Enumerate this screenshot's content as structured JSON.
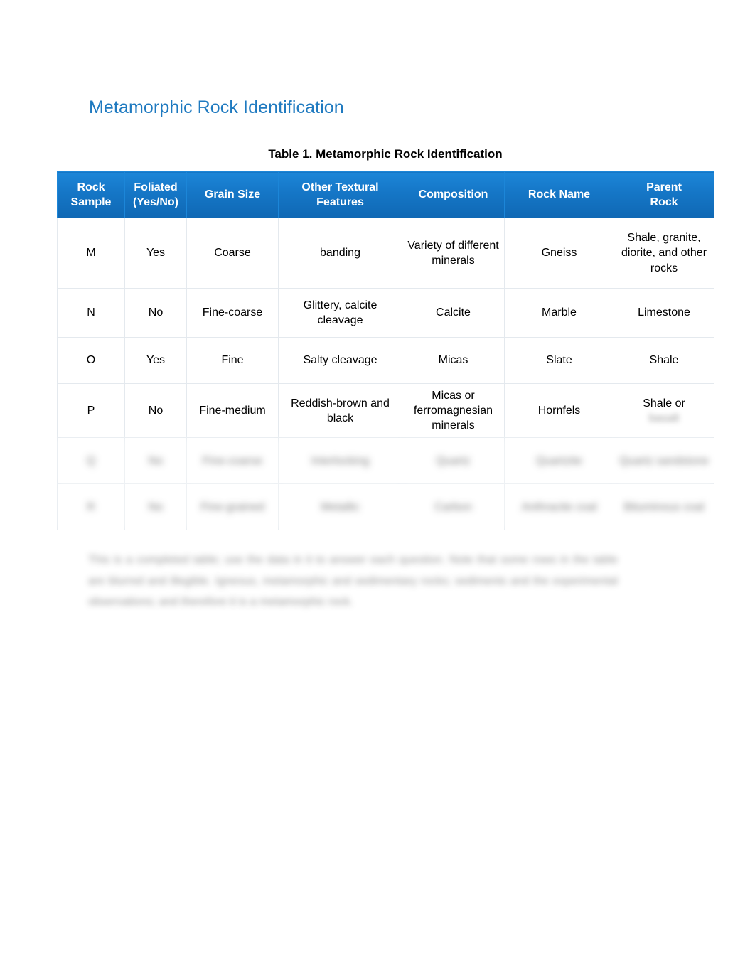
{
  "document": {
    "title": "Metamorphic Rock Identification",
    "title_color": "#1f7ac0",
    "table_caption": "Table 1. Metamorphic Rock Identification",
    "body_note": "This is a completed table; use the data in it to answer each question. Note that some rows in the table are blurred and illegible. Igneous, metamorphic and sedimentary rocks; sediments and the experimental observations; and therefore it is a metamorphic rock."
  },
  "table": {
    "header_color": "#1576c6",
    "header_text_color": "#ffffff",
    "columns": [
      "Rock Sample",
      "Foliated (Yes/No)",
      "Grain Size",
      "Other Textural Features",
      "Composition",
      "Rock Name",
      "Parent Rock"
    ],
    "columns_lines": [
      [
        "Rock",
        "Sample"
      ],
      [
        "Foliated",
        "(Yes/No)"
      ],
      [
        "Grain Size"
      ],
      [
        "Other Textural",
        "Features"
      ],
      [
        "Composition"
      ],
      [
        "Rock Name"
      ],
      [
        "Parent",
        "Rock"
      ]
    ],
    "rows": [
      {
        "legible": true,
        "sample": "M",
        "foliated": "Yes",
        "grain_size": "Coarse",
        "textural_features": "banding",
        "composition": "Variety of different minerals",
        "rock_name": "Gneiss",
        "parent_rock": "Shale, granite, diorite, and other rocks"
      },
      {
        "legible": true,
        "sample": "N",
        "foliated": "No",
        "grain_size": "Fine-coarse",
        "textural_features": "Glittery, calcite cleavage",
        "composition": "Calcite",
        "rock_name": "Marble",
        "parent_rock": "Limestone"
      },
      {
        "legible": true,
        "sample": "O",
        "foliated": "Yes",
        "grain_size": "Fine",
        "textural_features": "Salty cleavage",
        "composition": "Micas",
        "rock_name": "Slate",
        "parent_rock": "Shale"
      },
      {
        "legible": "partial",
        "sample": "P",
        "foliated": "No",
        "grain_size": "Fine-medium",
        "textural_features": "Reddish-brown and black",
        "composition": "Micas or ferromagnesian minerals",
        "rock_name": "Hornfels",
        "parent_rock": "Shale or",
        "parent_rock_blurred": "basalt"
      },
      {
        "legible": false,
        "sample": "Q",
        "foliated": "No",
        "grain_size": "Fine-coarse",
        "textural_features": "Interlocking",
        "composition": "Quartz",
        "rock_name": "Quartzite",
        "parent_rock": "Quartz sandstone"
      },
      {
        "legible": false,
        "sample": "R",
        "foliated": "No",
        "grain_size": "Fine-grained",
        "textural_features": "Metallic",
        "composition": "Carbon",
        "rock_name": "Anthracite coal",
        "parent_rock": "Bituminous coal"
      }
    ]
  }
}
